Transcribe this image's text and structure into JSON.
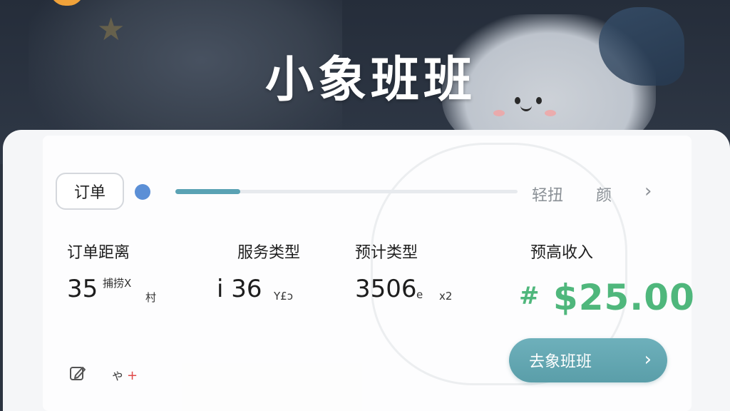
{
  "app": {
    "title": "小象班班"
  },
  "order_row": {
    "tab_label": "订单",
    "progress_fraction": 0.19,
    "right_texts": [
      "轻扭",
      "颜"
    ],
    "chevron": "›"
  },
  "stats": [
    {
      "label": "订单距离",
      "value": "35",
      "unit_top": "捕捞X",
      "unit_bottom": "村"
    },
    {
      "label": "服务类型",
      "value": "i 36",
      "unit_right": "Y£ɔ"
    },
    {
      "label": "预计类型",
      "value": "3506",
      "unit_mid": "e",
      "unit_right": "x2"
    },
    {
      "label": "预高收入",
      "currency_symbol": "#",
      "amount": "$25.00"
    }
  ],
  "actions": {
    "edit_icon": "edit-icon",
    "extra_label": "ゃ",
    "extra_plus": "+",
    "go_button_label": "去象班班",
    "go_button_chevron": "›"
  },
  "colors": {
    "header_bg": "#2b3340",
    "accent_teal": "#5a9ea9",
    "income_green": "#4fb77c",
    "dot_blue": "#5b8fd6",
    "plus_red": "#e04848"
  }
}
